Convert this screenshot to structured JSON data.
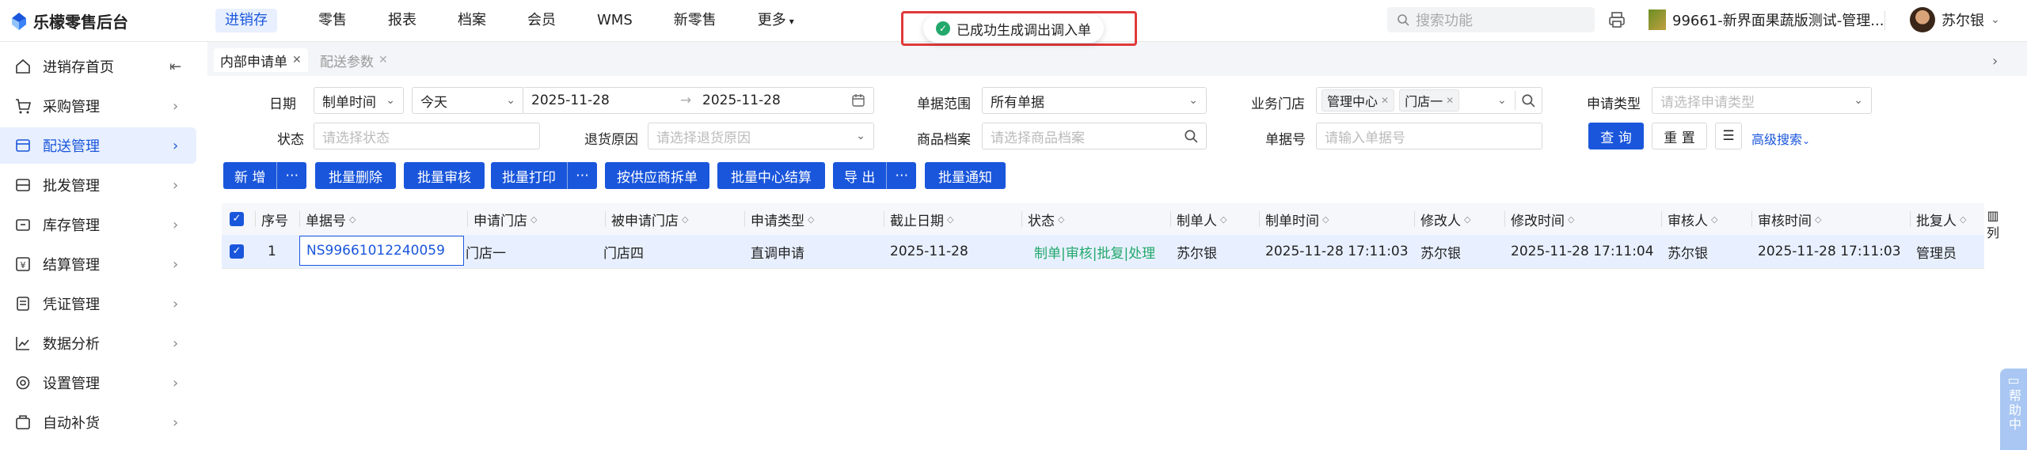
{
  "app": {
    "logo_text": "乐檬零售后台"
  },
  "nav": [
    {
      "label": "进销存",
      "active": true
    },
    {
      "label": "零售"
    },
    {
      "label": "报表"
    },
    {
      "label": "档案"
    },
    {
      "label": "会员"
    },
    {
      "label": "WMS"
    },
    {
      "label": "新零售"
    },
    {
      "label": "更多"
    }
  ],
  "header": {
    "search_placeholder": "搜索功能",
    "store_name": "99661-新界面果蔬版测试-管理...",
    "user_name": "苏尔银"
  },
  "toast": {
    "message": "已成功生成调出调入单",
    "color": "#22a86b"
  },
  "sidebar": [
    {
      "label": "进销存首页",
      "icon": "home-icon"
    },
    {
      "label": "采购管理",
      "icon": "cart-icon"
    },
    {
      "label": "配送管理",
      "icon": "delivery-icon",
      "active": true
    },
    {
      "label": "批发管理",
      "icon": "wholesale-icon"
    },
    {
      "label": "库存管理",
      "icon": "inventory-icon"
    },
    {
      "label": "结算管理",
      "icon": "settlement-icon"
    },
    {
      "label": "凭证管理",
      "icon": "voucher-icon"
    },
    {
      "label": "数据分析",
      "icon": "chart-icon"
    },
    {
      "label": "设置管理",
      "icon": "settings-icon"
    },
    {
      "label": "自动补货",
      "icon": "replenish-icon"
    }
  ],
  "tabs": [
    {
      "label": "内部申请单",
      "active": true
    },
    {
      "label": "配送参数"
    }
  ],
  "filters": {
    "date_label": "日期",
    "date_type": "制单时间",
    "date_preset": "今天",
    "date_start": "2025-11-28",
    "date_end": "2025-11-28",
    "scope_label": "单据范围",
    "scope_value": "所有单据",
    "store_label": "业务门店",
    "store_tags": [
      "管理中心",
      "门店一"
    ],
    "apply_type_label": "申请类型",
    "apply_type_placeholder": "请选择申请类型",
    "status_label": "状态",
    "status_placeholder": "请选择状态",
    "return_reason_label": "退货原因",
    "return_reason_placeholder": "请选择退货原因",
    "product_label": "商品档案",
    "product_placeholder": "请选择商品档案",
    "doc_no_label": "单据号",
    "doc_no_placeholder": "请输入单据号",
    "query": "查 询",
    "reset": "重 置",
    "advanced": "高级搜索"
  },
  "actions": {
    "add": "新 增",
    "batch_delete": "批量删除",
    "batch_review": "批量审核",
    "batch_print": "批量打印",
    "split_by_supplier": "按供应商拆单",
    "batch_center_settle": "批量中心结算",
    "export": "导 出",
    "batch_notify": "批量通知"
  },
  "table": {
    "columns": [
      "序号",
      "单据号",
      "申请门店",
      "被申请门店",
      "申请类型",
      "截止日期",
      "状态",
      "制单人",
      "制单时间",
      "修改人",
      "修改时间",
      "审核人",
      "审核时间",
      "批复人"
    ],
    "column_toggle": "列",
    "rows": [
      {
        "index": "1",
        "doc_no": "NS99661012240059",
        "apply_store": "门店一",
        "target_store": "门店四",
        "apply_type": "直调申请",
        "deadline": "2025-11-28",
        "status": "制单|审核|批复|处理",
        "creator": "苏尔银",
        "created_at": "2025-11-28 17:11:03",
        "modifier": "苏尔银",
        "modified_at": "2025-11-28 17:11:04",
        "reviewer": "苏尔银",
        "reviewed_at": "2025-11-28 17:11:03",
        "approver": "管理员"
      }
    ]
  },
  "help": {
    "label": "帮助中"
  }
}
